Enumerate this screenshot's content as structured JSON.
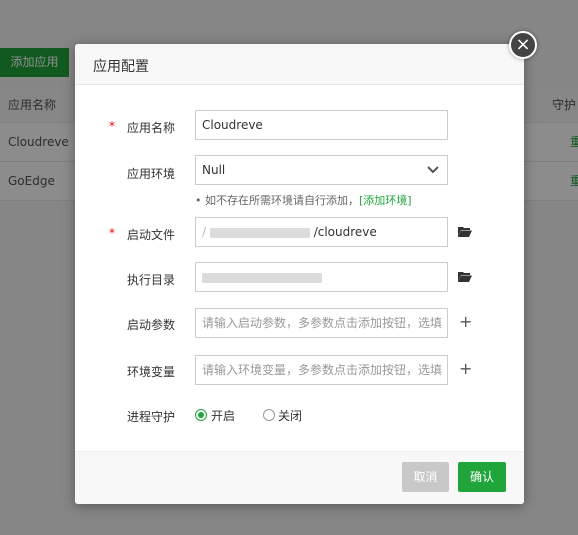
{
  "background": {
    "add_button": "添加应用",
    "table_header": {
      "name": "应用名称",
      "right": "守护"
    },
    "rows": [
      {
        "name": "Cloudreve",
        "action": "重"
      },
      {
        "name": "GoEdge",
        "action": "重"
      }
    ]
  },
  "dialog": {
    "title": "应用配置",
    "close": "×",
    "fields": {
      "app_name": {
        "label": "应用名称",
        "value": "Cloudreve"
      },
      "app_env": {
        "label": "应用环境",
        "value": "Null"
      },
      "env_hint": "如不存在所需环境请自行添加，",
      "env_hint_link": "[添加环境]",
      "start_file": {
        "label": "启动文件",
        "value_suffix": "/cloudreve"
      },
      "exec_dir": {
        "label": "执行目录"
      },
      "start_args": {
        "label": "启动参数",
        "placeholder": "请输入启动参数，多参数点击添加按钮，选填"
      },
      "env_vars": {
        "label": "环境变量",
        "placeholder": "请输入环境变量，多参数点击添加按钮，选填"
      },
      "daemon": {
        "label": "进程守护",
        "on": "开启",
        "off": "关闭",
        "selected": "开启"
      }
    },
    "buttons": {
      "cancel": "取消",
      "confirm": "确认"
    }
  },
  "colors": {
    "accent": "#20a53a",
    "required": "#ef0808"
  }
}
